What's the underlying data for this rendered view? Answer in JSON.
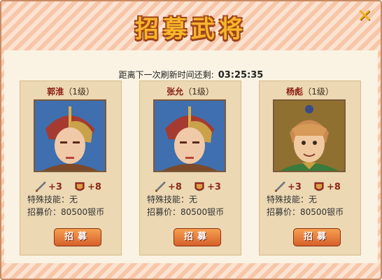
{
  "dialog": {
    "title": "招募武将",
    "close_symbol": "✕"
  },
  "refresh": {
    "label": "距离下一次刷新时间还剩:",
    "time": "03:25:35"
  },
  "generals": [
    {
      "name": "郭淮",
      "level": "（1级）",
      "attack_bonus": "+3",
      "defense_bonus": "+8",
      "skill": "特殊技能：无",
      "price": "招募价：80500银币",
      "button_label": "招募"
    },
    {
      "name": "张允",
      "level": "（1级）",
      "attack_bonus": "+8",
      "defense_bonus": "+3",
      "skill": "特殊技能：无",
      "price": "招募价：80500银币",
      "button_label": "招募"
    },
    {
      "name": "杨彪",
      "level": "（1级）",
      "attack_bonus": "+3",
      "defense_bonus": "+8",
      "skill": "特殊技能：无",
      "price": "招募价：80500银币",
      "button_label": "招募"
    }
  ]
}
